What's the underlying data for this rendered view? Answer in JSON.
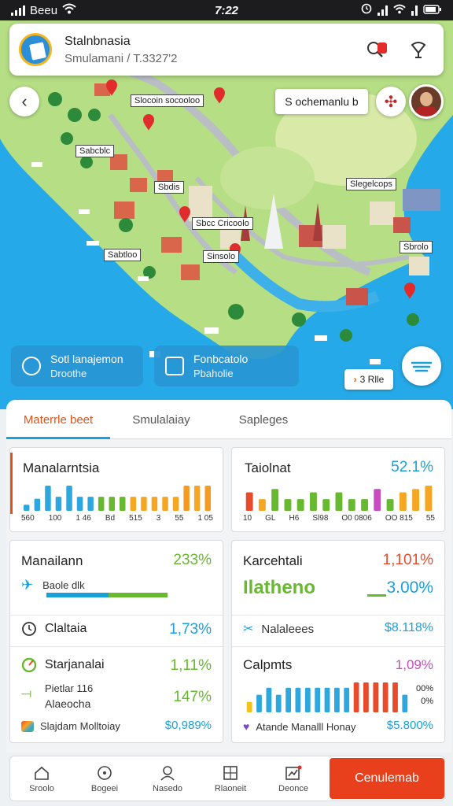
{
  "status_bar": {
    "carrier": "Beeu",
    "time": "7:22"
  },
  "search": {
    "title": "Stalnbnasia",
    "subtitle": "Smulamani / T.3327'2"
  },
  "map": {
    "chip_label": "S ochemanlu b",
    "labels": [
      "Slocoin socooloo",
      "Sabcblc",
      "Sbdis",
      "Slegelcops",
      "Sbcc Cricoolo",
      "Sabtloo",
      "Sinsolo",
      "Sbrolo"
    ],
    "overlay_left": {
      "title": "Sotl lanajemon",
      "subtitle": "Droothe"
    },
    "overlay_right": {
      "title": "Fonbcatolo",
      "subtitle": "Pbaholie"
    },
    "nav_chip": "3 Rlle"
  },
  "tabs": [
    "Materrle beet",
    "Smulalaiay",
    "Sapleges"
  ],
  "card1": {
    "title": "Manalarntsia",
    "axis": [
      "560",
      "100",
      "1 46",
      "Bd",
      "515",
      "3",
      "55",
      "1 05"
    ],
    "bars": [
      6,
      12,
      25,
      14,
      25,
      14,
      14,
      14,
      14,
      14,
      14,
      14,
      14,
      14,
      14,
      25,
      25,
      25
    ],
    "colors": [
      "#2ea7df",
      "#2ea7df",
      "#2ea7df",
      "#2ea7df",
      "#2ea7df",
      "#2ea7df",
      "#2ea7df",
      "#67b92f",
      "#67b92f",
      "#67b92f",
      "#f5a623",
      "#f5a623",
      "#f5a623",
      "#f5a623",
      "#f5a623",
      "#f59b22",
      "#f5a623",
      "#f59b22"
    ]
  },
  "card2": {
    "title": "Taiolnat",
    "value": "52.1%",
    "axis": [
      "10",
      "GL",
      "H6",
      "Sl98",
      "O0 0806",
      "OO 815",
      "55"
    ],
    "bars": [
      22,
      14,
      26,
      14,
      14,
      22,
      14,
      22,
      14,
      14,
      26,
      14,
      22,
      26,
      30
    ],
    "colors": [
      "#e84b2c",
      "#f5a623",
      "#67b92f",
      "#67b92f",
      "#67b92f",
      "#67b92f",
      "#67b92f",
      "#67b92f",
      "#67b92f",
      "#67b92f",
      "#c94bc1",
      "#67b92f",
      "#f5a623",
      "#f5a623",
      "#f5a623"
    ]
  },
  "card3": {
    "title": "Manailann",
    "value": "233%",
    "progress_label": "Baole dlk",
    "progress_value": 0.62,
    "row1": {
      "label": "Claltaia",
      "value": "1,73%"
    },
    "row2": {
      "label": "Starjanalai",
      "value": "1,11%"
    },
    "row3": {
      "label1": "Pietlar 116",
      "label2": "Alaeocha",
      "value": "147%"
    },
    "footer": {
      "label": "Slajdam Molltoiay",
      "value": "$0,989%"
    }
  },
  "card4": {
    "title": "Karcehtali",
    "value": "1,101%",
    "big_label": "Ilatheno",
    "big_value": "3.00%",
    "row1": {
      "label": "Nalaleees",
      "value": "$8.118%"
    },
    "chart_title": "Calpmts",
    "chart_value": "1,09%",
    "side_values": [
      "00%",
      "0%"
    ],
    "bars": [
      12,
      20,
      28,
      20,
      28,
      28,
      28,
      28,
      28,
      28,
      28,
      34,
      34,
      34,
      34,
      34,
      20
    ],
    "colors": [
      "#f5c21b",
      "#2ea7df",
      "#2ea7df",
      "#2ea7df",
      "#2ea7df",
      "#2ea7df",
      "#2ea7df",
      "#2ea7df",
      "#2ea7df",
      "#2ea7df",
      "#2ea7df",
      "#e84b2c",
      "#e84b2c",
      "#e84b2c",
      "#e84b2c",
      "#e84b2c",
      "#2ea7df"
    ],
    "footer": {
      "label": "Atande Manalll Honay",
      "value": "$5.800%"
    }
  },
  "bottom_nav": [
    {
      "label": "Sroolo",
      "icon": "home-icon"
    },
    {
      "label": "Bogeei",
      "icon": "compass-icon"
    },
    {
      "label": "Nasedo",
      "icon": "profile-icon"
    },
    {
      "label": "Rlaoneit",
      "icon": "calculator-icon"
    },
    {
      "label": "Deonce",
      "icon": "chart-icon"
    }
  ],
  "cta_label": "Cenulemab"
}
